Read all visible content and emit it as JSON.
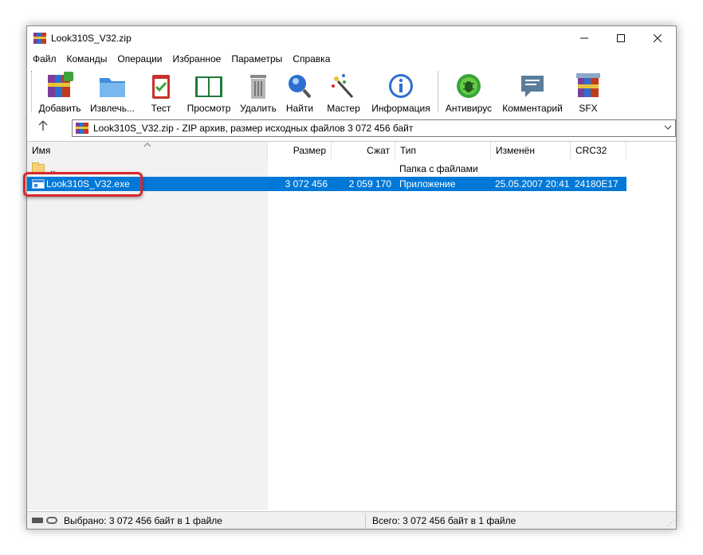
{
  "window": {
    "title": "Look310S_V32.zip"
  },
  "menu": [
    {
      "label": "Файл"
    },
    {
      "label": "Команды"
    },
    {
      "label": "Операции"
    },
    {
      "label": "Избранное"
    },
    {
      "label": "Параметры"
    },
    {
      "label": "Справка"
    }
  ],
  "toolbar": [
    {
      "label": "Добавить",
      "icon": "add-archive-icon"
    },
    {
      "label": "Извлечь...",
      "icon": "extract-folder-icon"
    },
    {
      "label": "Тест",
      "icon": "test-clipboard-icon"
    },
    {
      "label": "Просмотр",
      "icon": "view-book-icon"
    },
    {
      "label": "Удалить",
      "icon": "trash-icon"
    },
    {
      "label": "Найти",
      "icon": "magnifier-icon"
    },
    {
      "label": "Мастер",
      "icon": "wizard-wand-icon"
    },
    {
      "label": "Информация",
      "icon": "info-icon"
    },
    {
      "label": "Антивирус",
      "icon": "antivirus-bug-icon"
    },
    {
      "label": "Комментарий",
      "icon": "comment-bubble-icon"
    },
    {
      "label": "SFX",
      "icon": "sfx-archive-icon"
    }
  ],
  "address": {
    "text": "Look310S_V32.zip - ZIP архив, размер исходных файлов 3 072 456 байт"
  },
  "columns": {
    "name": "Имя",
    "size": "Размер",
    "packed": "Сжат",
    "type": "Тип",
    "modified": "Изменён",
    "crc": "CRC32"
  },
  "rows": [
    {
      "name": "..",
      "size": "",
      "packed": "",
      "type": "Папка с файлами",
      "modified": "",
      "crc": "",
      "icon": "folder-up-icon"
    },
    {
      "name": "Look310S_V32.exe",
      "size": "3 072 456",
      "packed": "2 059 170",
      "type": "Приложение",
      "modified": "25.05.2007 20:41",
      "crc": "24180E17",
      "icon": "exe-icon",
      "selected": true
    }
  ],
  "status": {
    "left": "Выбрано: 3 072 456 байт в 1 файле",
    "right": "Всего: 3 072 456 байт в 1 файле"
  },
  "colors": {
    "selection": "#0078d7",
    "highlight_ring": "#d9272e"
  }
}
